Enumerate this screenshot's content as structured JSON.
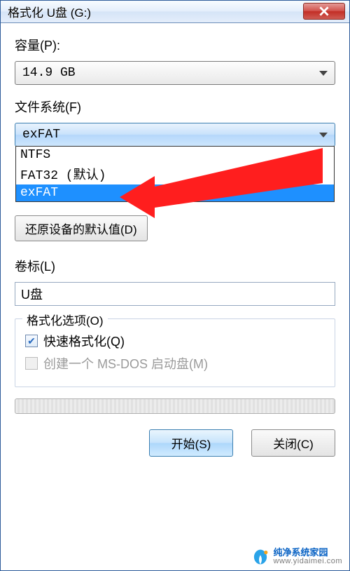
{
  "window": {
    "title": "格式化 U盘 (G:)"
  },
  "capacity": {
    "label": "容量(P):",
    "value": "14.9 GB"
  },
  "filesystem": {
    "label": "文件系统(F)",
    "value": "exFAT",
    "options": [
      {
        "label": "NTFS",
        "selected": false
      },
      {
        "label": "FAT32 (默认)",
        "selected": false
      },
      {
        "label": "exFAT",
        "selected": true
      }
    ]
  },
  "restore_defaults": {
    "label": "还原设备的默认值(D)"
  },
  "volume": {
    "label": "卷标(L)",
    "value": "U盘"
  },
  "options": {
    "legend": "格式化选项(O)",
    "quick_format": {
      "label": "快速格式化(Q)",
      "checked": true
    },
    "msdos_boot": {
      "label": "创建一个 MS-DOS 启动盘(M)",
      "checked": false,
      "disabled": true
    }
  },
  "buttons": {
    "start": "开始(S)",
    "close": "关闭(C)"
  },
  "watermark": {
    "main": "纯净系统家园",
    "sub": "www.yidaimei.com"
  }
}
